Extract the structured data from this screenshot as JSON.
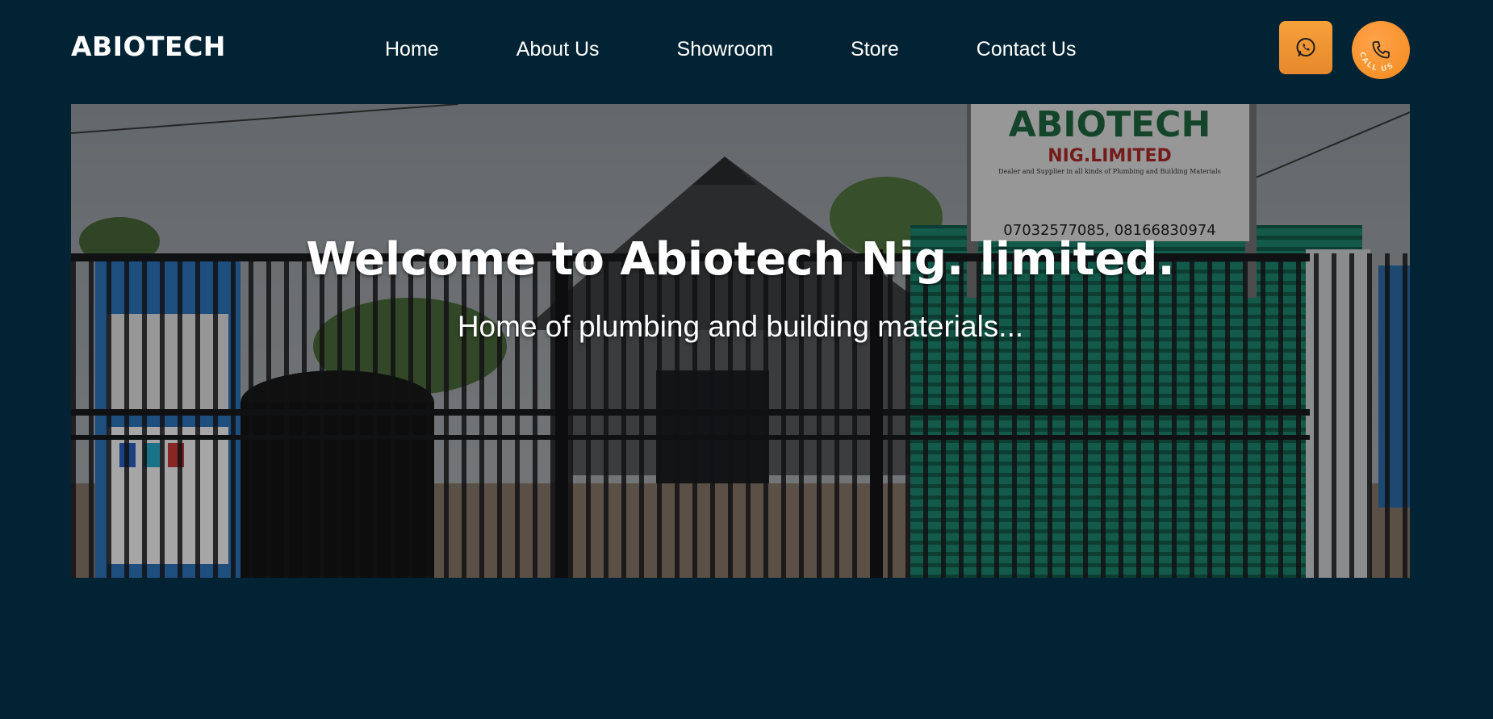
{
  "header": {
    "logo": "ABIOTECH",
    "nav": [
      {
        "label": "Home"
      },
      {
        "label": "About Us"
      },
      {
        "label": "Showroom"
      },
      {
        "label": "Store"
      },
      {
        "label": "Contact Us"
      }
    ],
    "whatsapp_icon": "whatsapp-icon",
    "call_icon": "phone-icon",
    "call_label": "CALL US"
  },
  "hero": {
    "title": "Welcome to Abiotech Nig. limited.",
    "subtitle": "Home of plumbing and building materials...",
    "sign": {
      "name": "ABIOTECH",
      "company": "NIG.LIMITED",
      "tagline": "Dealer and Supplier in all kinds of Plumbing and Building Materials",
      "phones": "07032577085, 08166830974"
    }
  },
  "colors": {
    "background": "#022333",
    "accent": "#f28b1d",
    "text": "#ffffff"
  }
}
